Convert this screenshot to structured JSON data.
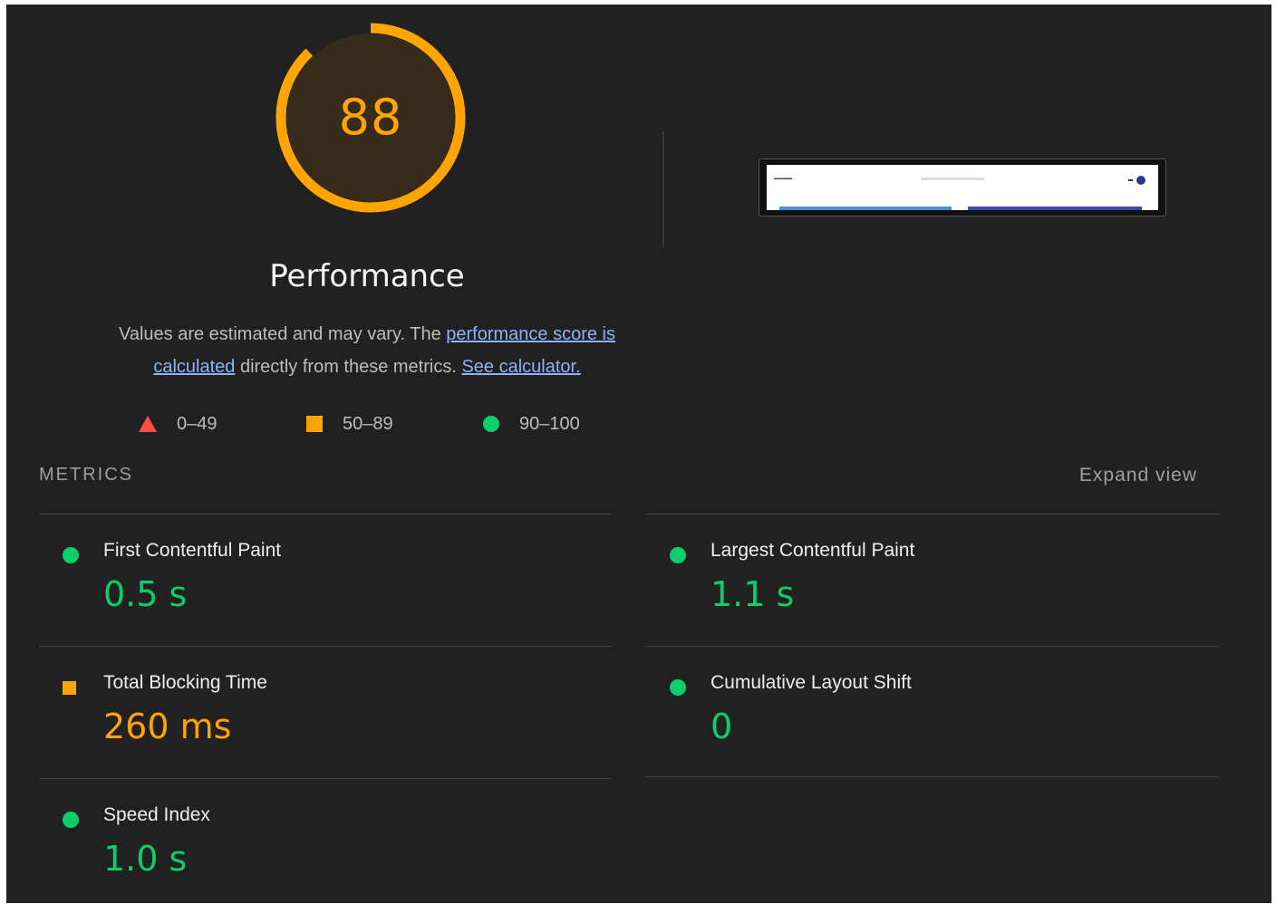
{
  "gauge": {
    "score": "88",
    "score_fraction": 0.88,
    "title": "Performance",
    "color": "#ffa400"
  },
  "description": {
    "text_before": "Values are estimated and may vary. The ",
    "link_score": "performance score is calculated",
    "text_middle": " directly from these metrics. ",
    "link_calculator": "See calculator."
  },
  "legend": [
    {
      "shape": "triangle",
      "range": "0–49",
      "color": "#ff4e42"
    },
    {
      "shape": "square",
      "range": "50–89",
      "color": "#ffa400"
    },
    {
      "shape": "circle",
      "range": "90–100",
      "color": "#0cce6b"
    }
  ],
  "metrics_header": {
    "label": "METRICS",
    "expand_label": "Expand view"
  },
  "metrics": [
    {
      "title": "First Contentful Paint",
      "value": "0.5 s",
      "status": "pass"
    },
    {
      "title": "Largest Contentful Paint",
      "value": "1.1 s",
      "status": "pass"
    },
    {
      "title": "Total Blocking Time",
      "value": "260 ms",
      "status": "average"
    },
    {
      "title": "Cumulative Layout Shift",
      "value": "0",
      "status": "pass"
    },
    {
      "title": "Speed Index",
      "value": "1.0 s",
      "status": "pass"
    }
  ],
  "colors": {
    "background": "#212121",
    "pass": "#0cce6b",
    "average": "#ffa400",
    "fail": "#ff4e42",
    "link": "#8ab4f8"
  }
}
